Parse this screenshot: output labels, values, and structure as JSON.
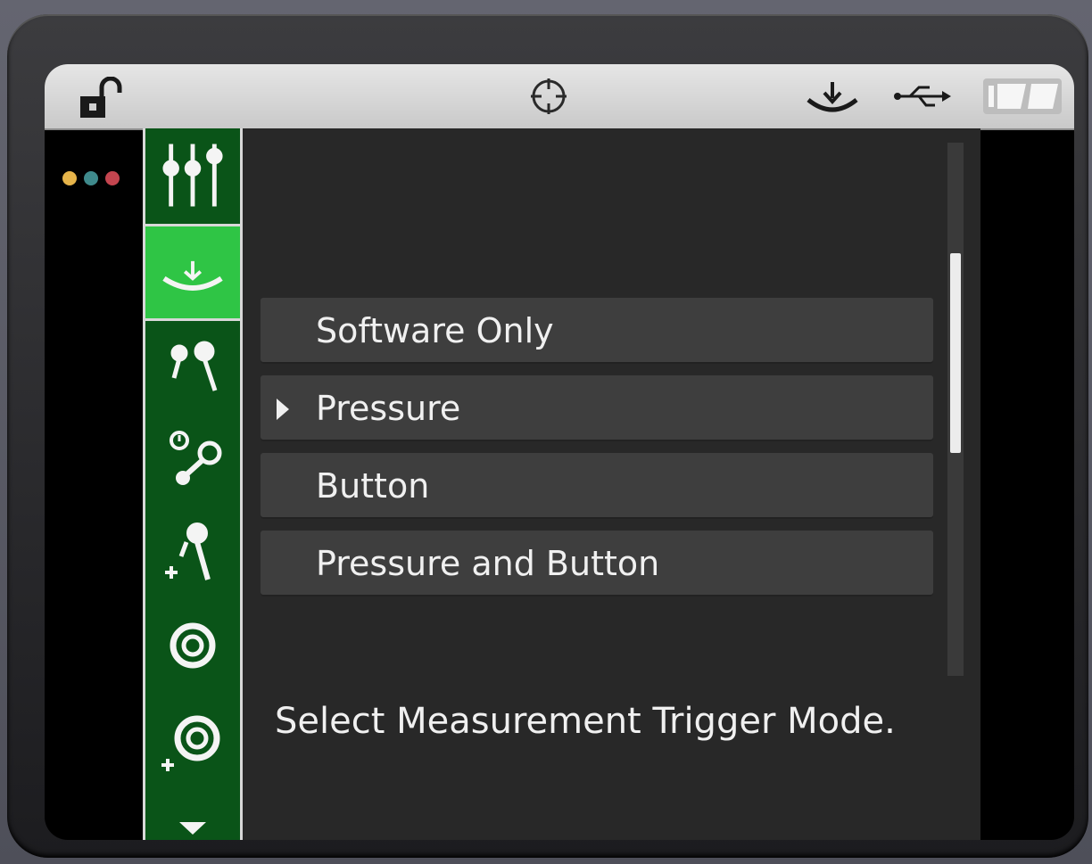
{
  "status_bar": {
    "icons": [
      "lock-open-icon",
      "crosshair-target-icon",
      "trigger-icon",
      "usb-icon",
      "battery-icon"
    ]
  },
  "indicator_dots": {
    "colors": [
      "#e6b44a",
      "#3f8a8c",
      "#c4454f"
    ]
  },
  "sidebar": {
    "items": [
      {
        "icon": "sliders-icon",
        "active": false
      },
      {
        "icon": "measurement-trigger-icon",
        "active": true
      },
      {
        "icon": "probe-pair-icon",
        "active": false
      },
      {
        "icon": "probe-timer-icon",
        "active": false
      },
      {
        "icon": "probe-add-icon",
        "active": false
      },
      {
        "icon": "target-circle-icon",
        "active": false
      },
      {
        "icon": "target-add-icon",
        "active": false
      },
      {
        "icon": "scroll-down-arrow-icon",
        "active": false
      }
    ]
  },
  "menu": {
    "options": [
      {
        "label": "Software Only",
        "selected": false
      },
      {
        "label": "Pressure",
        "selected": true
      },
      {
        "label": "Button",
        "selected": false
      },
      {
        "label": "Pressure and Button",
        "selected": false
      }
    ]
  },
  "help_text": "Select Measurement Trigger Mode.",
  "colors": {
    "sidebar_bg": "#0a5418",
    "sidebar_active": "#2fc545",
    "panel_bg": "#282828",
    "row_bg": "#3e3e3e",
    "text": "#f0f0f0"
  }
}
